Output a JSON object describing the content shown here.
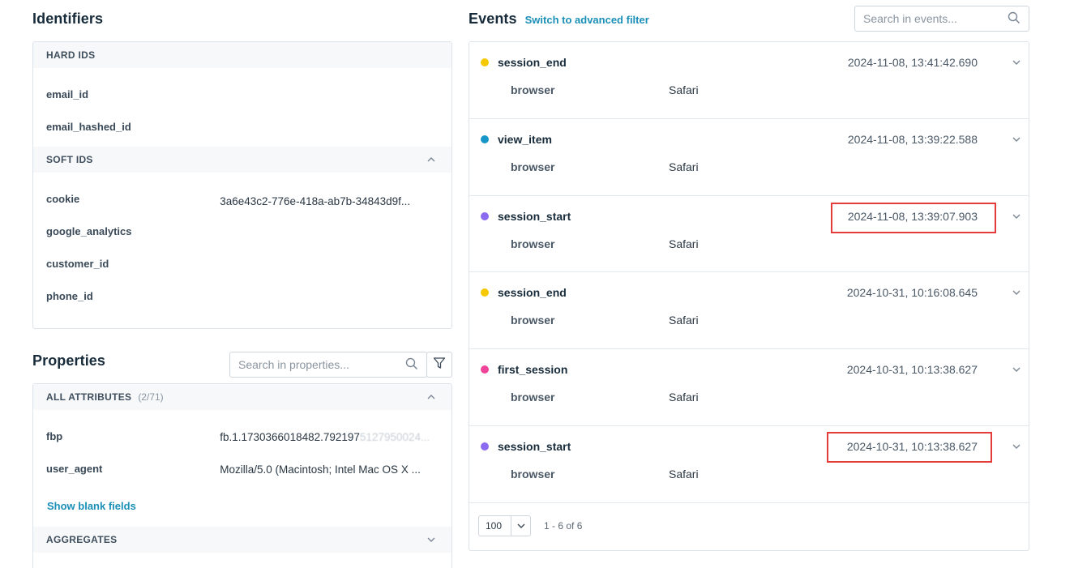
{
  "identifiers": {
    "title": "Identifiers",
    "hard_ids": {
      "label": "HARD IDS",
      "rows": [
        {
          "key": "email_id",
          "value": ""
        },
        {
          "key": "email_hashed_id",
          "value": ""
        }
      ]
    },
    "soft_ids": {
      "label": "SOFT IDS",
      "rows": [
        {
          "key": "cookie",
          "value": "3a6e43c2-776e-418a-ab7b-34843d9f..."
        },
        {
          "key": "google_analytics",
          "value": ""
        },
        {
          "key": "customer_id",
          "value": ""
        },
        {
          "key": "phone_id",
          "value": ""
        }
      ]
    }
  },
  "properties": {
    "title": "Properties",
    "search_placeholder": "Search in properties...",
    "all_attributes": {
      "label": "ALL ATTRIBUTES",
      "count": "(2/71)",
      "rows": [
        {
          "key": "fbp",
          "value": "fb.1.1730366018482.792197",
          "value_masked": "5127950024..."
        },
        {
          "key": "user_agent",
          "value": "Mozilla/5.0 (Macintosh; Intel Mac OS X ..."
        }
      ]
    },
    "show_blank": "Show blank fields",
    "aggregates_label": "AGGREGATES"
  },
  "events": {
    "title": "Events",
    "advanced_filter_link": "Switch to advanced filter",
    "search_placeholder": "Search in events...",
    "items": [
      {
        "name": "session_end",
        "timestamp": "2024-11-08, 13:41:42.690",
        "prop_key": "browser",
        "prop_value": "Safari",
        "dot_color": "#f5c800"
      },
      {
        "name": "view_item",
        "timestamp": "2024-11-08, 13:39:22.588",
        "prop_key": "browser",
        "prop_value": "Safari",
        "dot_color": "#1796c8"
      },
      {
        "name": "session_start",
        "timestamp": "2024-11-08, 13:39:07.903",
        "prop_key": "browser",
        "prop_value": "Safari",
        "dot_color": "#8b6cf0"
      },
      {
        "name": "session_end",
        "timestamp": "2024-10-31, 10:16:08.645",
        "prop_key": "browser",
        "prop_value": "Safari",
        "dot_color": "#f5c800"
      },
      {
        "name": "first_session",
        "timestamp": "2024-10-31, 10:13:38.627",
        "prop_key": "browser",
        "prop_value": "Safari",
        "dot_color": "#f0449a"
      },
      {
        "name": "session_start",
        "timestamp": "2024-10-31, 10:13:38.627",
        "prop_key": "browser",
        "prop_value": "Safari",
        "dot_color": "#8b6cf0"
      }
    ],
    "pager": {
      "page_size": "100",
      "range": "1 - 6 of 6"
    }
  },
  "colors": {
    "accent_link": "#1a8fb8",
    "highlight_box": "#e53b3b"
  }
}
